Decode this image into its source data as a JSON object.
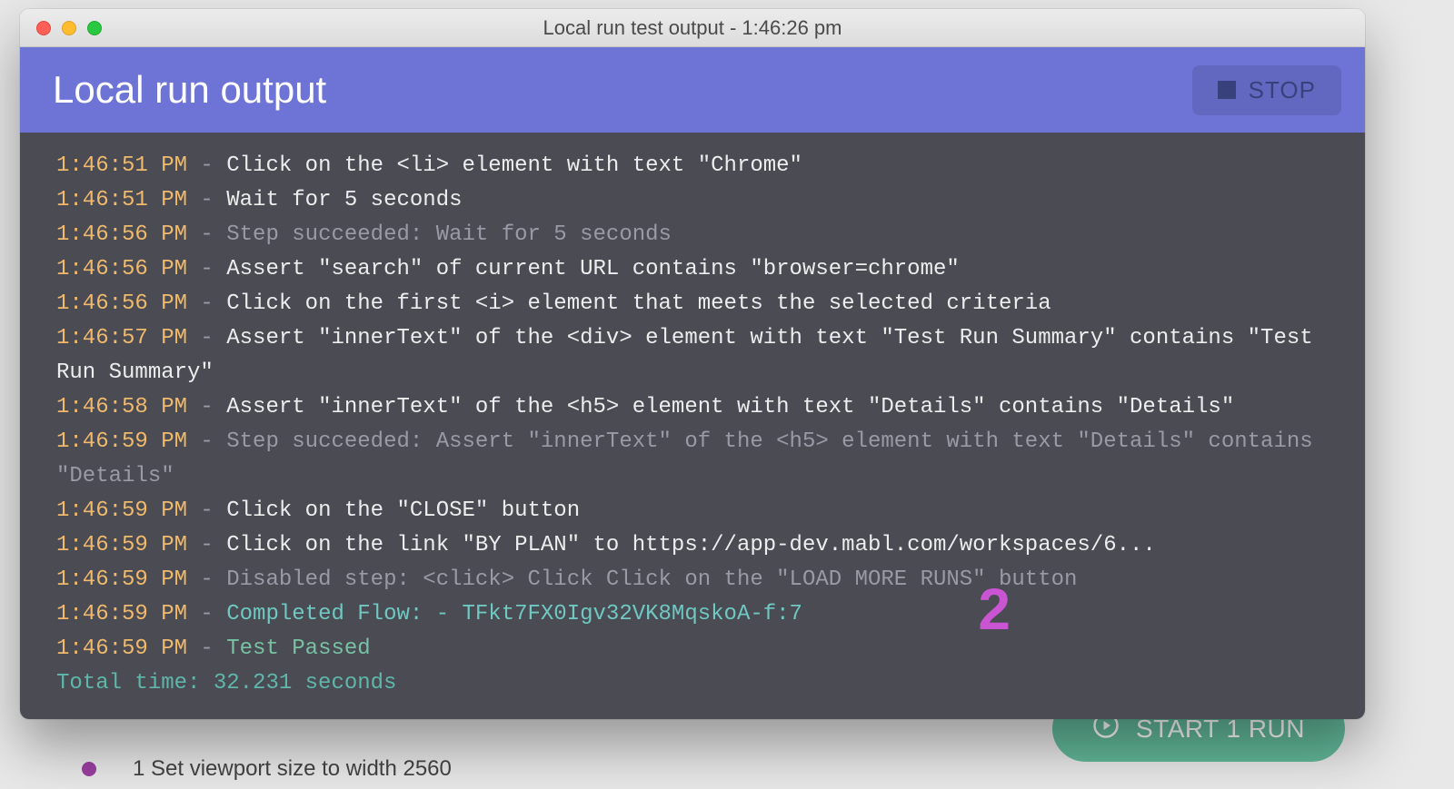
{
  "mac_title": "Local run test output - 1:46:26 pm",
  "panel": {
    "title": "Local run output",
    "stop_label": "STOP"
  },
  "logs": [
    {
      "ts": "1:46:51 PM",
      "msg": "Click on the <li> element with text \"Chrome\"",
      "cls": "msg-white"
    },
    {
      "ts": "1:46:51 PM",
      "msg": "Wait for 5 seconds",
      "cls": "msg-white"
    },
    {
      "ts": "1:46:56 PM",
      "msg": "Step succeeded: Wait for 5 seconds",
      "cls": "msg-gray"
    },
    {
      "ts": "1:46:56 PM",
      "msg": "Assert \"search\" of current URL contains \"browser=chrome\"",
      "cls": "msg-white"
    },
    {
      "ts": "1:46:56 PM",
      "msg": "Click on the first <i> element that meets the selected criteria",
      "cls": "msg-white"
    },
    {
      "ts": "1:46:57 PM",
      "msg": "Assert \"innerText\" of the <div> element with text \"Test Run Summary\" contains \"Test Run Summary\"",
      "cls": "msg-white"
    },
    {
      "ts": "1:46:58 PM",
      "msg": "Assert \"innerText\" of the <h5> element with text \"Details\" contains \"Details\"",
      "cls": "msg-white"
    },
    {
      "ts": "1:46:59 PM",
      "msg": "Step succeeded: Assert \"innerText\" of the <h5> element with text \"Details\" contains \"Details\"",
      "cls": "msg-gray"
    },
    {
      "ts": "1:46:59 PM",
      "msg": "Click on the \"CLOSE\" button",
      "cls": "msg-white"
    },
    {
      "ts": "1:46:59 PM",
      "msg": "Click on the link \"BY PLAN\" to https://app-dev.mabl.com/workspaces/6...",
      "cls": "msg-white"
    },
    {
      "ts": "1:46:59 PM",
      "msg": "Disabled step: <click> Click Click on the \"LOAD MORE RUNS\" button",
      "cls": "msg-gray"
    },
    {
      "ts": "1:46:59 PM",
      "msg": "Completed Flow: - TFkt7FX0Igv32VK8MqskoA-f:7",
      "cls": "msg-teal"
    },
    {
      "ts": "1:46:59 PM",
      "msg": "Test Passed",
      "cls": "msg-green"
    }
  ],
  "total_time": "Total time: 32.231 seconds",
  "annotation": "2",
  "bg": {
    "step_text": "1  Set viewport size to width 2560",
    "start_run_label": "START 1 RUN"
  }
}
